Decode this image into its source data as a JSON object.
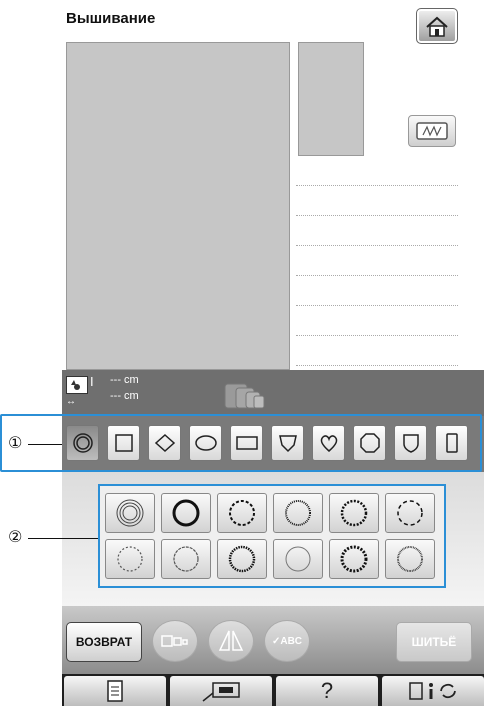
{
  "title": "Вышивание",
  "size_display": {
    "height": "--- cm",
    "width": "--- cm"
  },
  "callouts": {
    "one": "①",
    "two": "②"
  },
  "shapes": [
    {
      "name": "circle",
      "selected": true
    },
    {
      "name": "square",
      "selected": false
    },
    {
      "name": "diamond",
      "selected": false
    },
    {
      "name": "oval",
      "selected": false
    },
    {
      "name": "rectangle",
      "selected": false
    },
    {
      "name": "shield-pointed",
      "selected": false
    },
    {
      "name": "heart",
      "selected": false
    },
    {
      "name": "octagon",
      "selected": false
    },
    {
      "name": "shield",
      "selected": false
    },
    {
      "name": "tall-rectangle",
      "selected": false
    }
  ],
  "buttons": {
    "back": "ВОЗВРАТ",
    "abc": "ABC",
    "sew": "ШИТЬЁ",
    "help": "?"
  },
  "colors": {
    "accent": "#2b8fd6",
    "status_bar": "#6f6f6f",
    "toolbar": "#1f1f1f"
  }
}
